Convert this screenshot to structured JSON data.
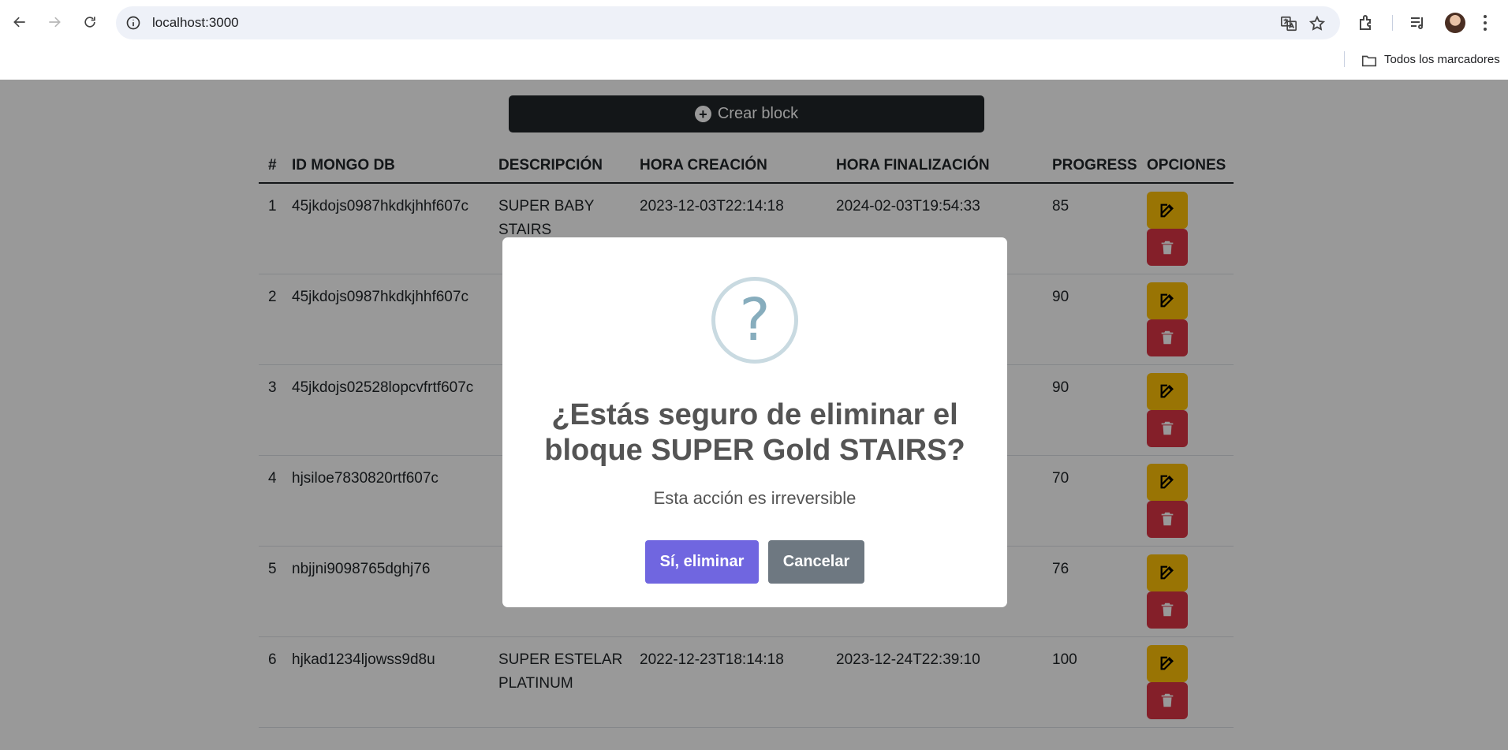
{
  "browser": {
    "url": "localhost:3000",
    "bookmarks_label": "Todos los marcadores"
  },
  "page": {
    "create_button_label": "Crear block",
    "table": {
      "headers": [
        "#",
        "ID MONGO DB",
        "DESCRIPCIÓN",
        "HORA CREACIÓN",
        "HORA FINALIZACIÓN",
        "PROGRESS",
        "OPCIONES"
      ],
      "rows": [
        {
          "num": "1",
          "id": "45jkdojs0987hkdkjhhf607c",
          "desc": "SUPER BABY STAIRS",
          "start": "2023-12-03T22:14:18",
          "end": "2024-02-03T19:54:33",
          "progress": "85"
        },
        {
          "num": "2",
          "id": "45jkdojs0987hkdkjhhf607c",
          "desc": "",
          "start": "",
          "end": "",
          "progress": "90"
        },
        {
          "num": "3",
          "id": "45jkdojs02528lopcvfrtf607c",
          "desc": "",
          "start": "",
          "end": "",
          "progress": "90"
        },
        {
          "num": "4",
          "id": "hjsiloe7830820rtf607c",
          "desc": "",
          "start": "",
          "end": "",
          "progress": "70"
        },
        {
          "num": "5",
          "id": "nbjjni9098765dghj76",
          "desc": "",
          "start": "",
          "end": "",
          "progress": "76"
        },
        {
          "num": "6",
          "id": "hjkad1234ljowss9d8u",
          "desc": "SUPER ESTELAR PLATINUM",
          "start": "2022-12-23T18:14:18",
          "end": "2023-12-24T22:39:10",
          "progress": "100"
        }
      ]
    }
  },
  "modal": {
    "icon": "?",
    "title": "¿Estás seguro de eliminar el bloque SUPER Gold STAIRS?",
    "text": "Esta acción es irreversible",
    "confirm_label": "Sí, eliminar",
    "cancel_label": "Cancelar"
  },
  "colors": {
    "confirm": "#7066e0",
    "cancel": "#6e7881",
    "edit": "#ffc107",
    "delete": "#dc3545",
    "create": "#212529"
  }
}
